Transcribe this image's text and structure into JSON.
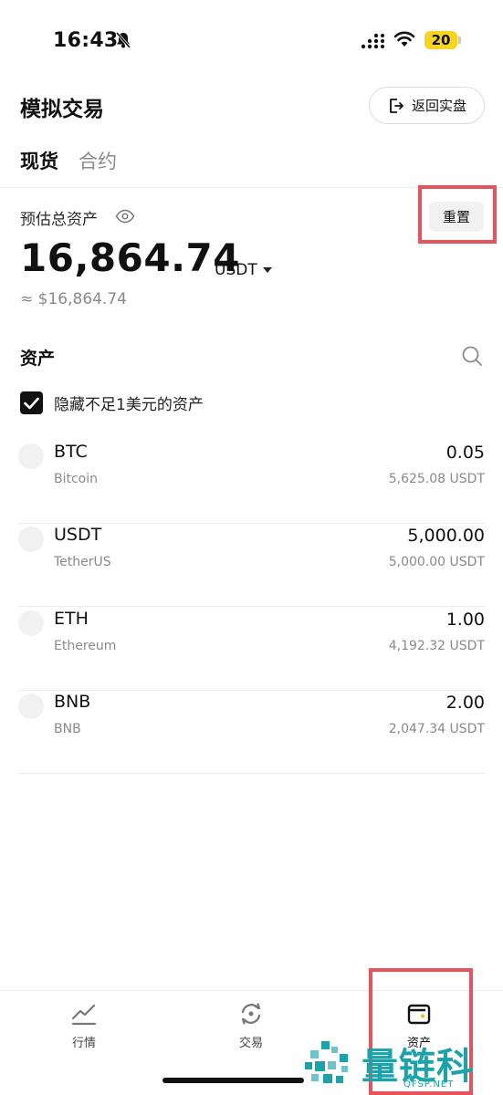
{
  "status_bar": {
    "time": "16:43",
    "battery": "20"
  },
  "header": {
    "title": "模拟交易",
    "return_label": "返回实盘"
  },
  "tabs": [
    {
      "label": "现货",
      "active": true
    },
    {
      "label": "合约",
      "active": false
    }
  ],
  "overview": {
    "label": "预估总资产",
    "total": "16,864.74",
    "unit": "USDT",
    "approx": "≈ $16,864.74",
    "reset_label": "重置"
  },
  "assets": {
    "title": "资产",
    "hide_small_label": "隐藏不足1美元的资产",
    "hide_small_checked": true,
    "items": [
      {
        "symbol": "BTC",
        "name": "Bitcoin",
        "qty": "0.05",
        "usdt": "5,625.08 USDT"
      },
      {
        "symbol": "USDT",
        "name": "TetherUS",
        "qty": "5,000.00",
        "usdt": "5,000.00 USDT"
      },
      {
        "symbol": "ETH",
        "name": "Ethereum",
        "qty": "1.00",
        "usdt": "4,192.32 USDT"
      },
      {
        "symbol": "BNB",
        "name": "BNB",
        "qty": "2.00",
        "usdt": "2,047.34 USDT"
      }
    ]
  },
  "nav": {
    "markets": "行情",
    "trade": "交易",
    "assets": "资产"
  },
  "watermark": {
    "text": "量链科技",
    "sub": "QFSP.NET"
  },
  "colors": {
    "highlight": "#e8535b",
    "battery": "#f7d51f",
    "watermark": "#1aa3a9"
  }
}
